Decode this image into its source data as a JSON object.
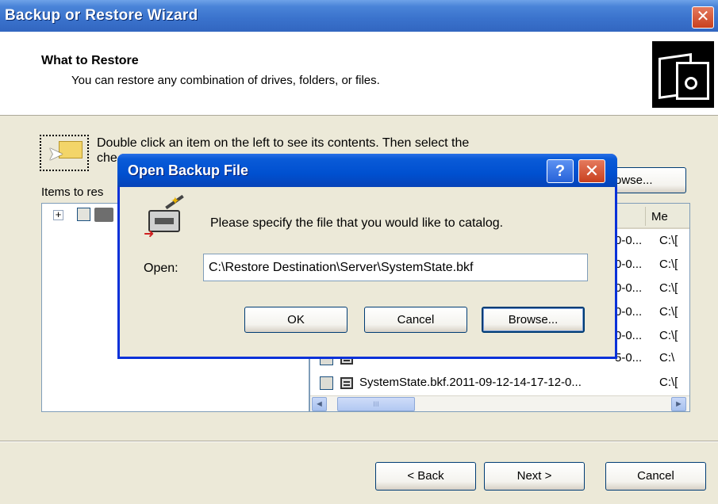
{
  "wizard": {
    "title": "Backup or Restore Wizard",
    "close_glyph": "✕",
    "header_title": "What to Restore",
    "header_subtitle": "You can restore any combination of drives, folders, or files.",
    "instruction_line1": "Double click an item on the left to see its contents. Then select the",
    "instruction_line2": "che",
    "items_label": "Items to res",
    "browse_label": "owse...",
    "tree": {
      "expander": "+"
    },
    "list": {
      "column_location": "Me",
      "rows": [
        {
          "name": "",
          "loc": "C:\\[",
          "name_tail": "0-0..."
        },
        {
          "name": "",
          "loc": "C:\\[",
          "name_tail": "0-0..."
        },
        {
          "name": "",
          "loc": "C:\\[",
          "name_tail": "0-0..."
        },
        {
          "name": "",
          "loc": "C:\\[",
          "name_tail": "0-0..."
        },
        {
          "name": "",
          "loc": "C:\\[",
          "name_tail": "0-0..."
        },
        {
          "name": "",
          "loc": "C:\\",
          "name_tail": "5-0..."
        },
        {
          "name": "SystemState.bkf.2011-09-12-14-17-12-0...",
          "loc": "C:\\[",
          "name_tail": ""
        }
      ],
      "scroll_left": "◄",
      "scroll_right": "►",
      "thumb_grip": "III"
    },
    "buttons": {
      "back": "< Back",
      "next": "Next >",
      "cancel": "Cancel"
    }
  },
  "dialog": {
    "title": "Open Backup File",
    "help_glyph": "?",
    "close_glyph": "✕",
    "message": "Please specify the file that you would like to catalog.",
    "open_label": "Open:",
    "open_value": "C:\\Restore Destination\\Server\\SystemState.bkf",
    "buttons": {
      "ok": "OK",
      "cancel": "Cancel",
      "browse": "Browse..."
    }
  }
}
